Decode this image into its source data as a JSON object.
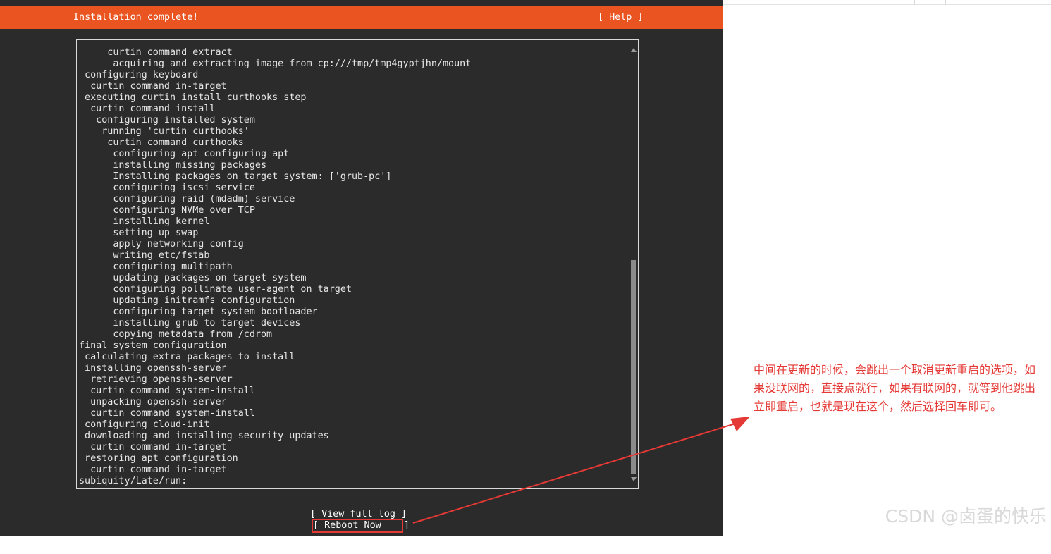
{
  "header": {
    "title": "Installation complete!",
    "help_label": "[ Help ]"
  },
  "log": {
    "lines": [
      "     curtin command extract",
      "      acquiring and extracting image from cp:///tmp/tmp4gyptjhn/mount",
      " configuring keyboard",
      "  curtin command in-target",
      " executing curtin install curthooks step",
      "  curtin command install",
      "   configuring installed system",
      "    running 'curtin curthooks'",
      "     curtin command curthooks",
      "      configuring apt configuring apt",
      "      installing missing packages",
      "      Installing packages on target system: ['grub-pc']",
      "      configuring iscsi service",
      "      configuring raid (mdadm) service",
      "      configuring NVMe over TCP",
      "      installing kernel",
      "      setting up swap",
      "      apply networking config",
      "      writing etc/fstab",
      "      configuring multipath",
      "      updating packages on target system",
      "      configuring pollinate user-agent on target",
      "      updating initramfs configuration",
      "      configuring target system bootloader",
      "      installing grub to target devices",
      "      copying metadata from /cdrom",
      "final system configuration",
      " calculating extra packages to install",
      " installing openssh-server",
      "  retrieving openssh-server",
      "  curtin command system-install",
      "  unpacking openssh-server",
      "  curtin command system-install",
      " configuring cloud-init",
      " downloading and installing security updates",
      "  curtin command in-target",
      " restoring apt configuration",
      "  curtin command in-target",
      "subiquity/Late/run:"
    ]
  },
  "buttons": {
    "view_full_log": "[ View full log ]",
    "reboot_now": "[ Reboot Now    ]"
  },
  "annotation": {
    "text": "中间在更新的时候，会跳出一个取消更新重启的选项，如果没联网的，直接点就行，如果有联网的，就等到他跳出立即重启，也就是现在这个，然后选择回车即可。"
  },
  "watermark": {
    "text": "CSDN @卤蛋的快乐"
  },
  "colors": {
    "header_bg": "#e95420",
    "terminal_bg": "#2b2b2b",
    "annotation": "#e53935"
  },
  "icons": {
    "scroll_up": "triangle-up-icon",
    "scroll_down": "triangle-down-icon",
    "arrow": "red-arrow-icon"
  }
}
